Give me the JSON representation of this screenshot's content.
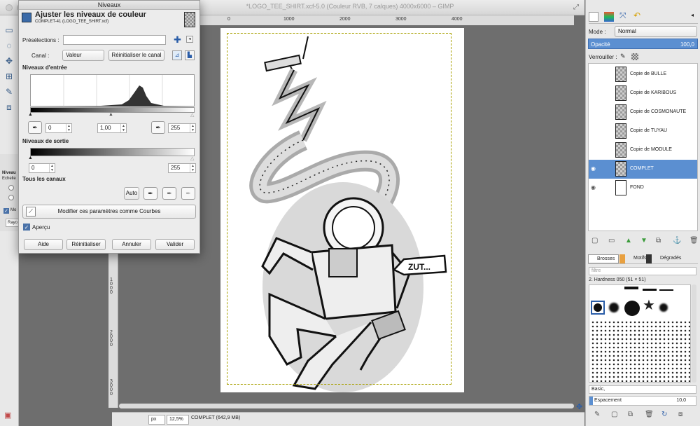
{
  "main_window": {
    "title": "*LOGO_TEE_SHIRT.xcf-5.0 (Couleur RVB, 7 calques) 4000x6000 – GIMP"
  },
  "rulers": {
    "h_labels": [
      "0",
      "1000",
      "2000",
      "3000",
      "4000"
    ],
    "v_labels": [
      "1000",
      "2000",
      "3000",
      "4000",
      "5000"
    ]
  },
  "toolbox_partial": {
    "labels": [
      "Niveau",
      "Echelle",
      "Mo",
      "Rayo"
    ]
  },
  "statusbar": {
    "unit": "px",
    "zoom": "12,5%",
    "info": "COMPLET (642,9 MB)"
  },
  "canvas": {
    "speech_bubble": "ZUT..."
  },
  "dialog": {
    "window_title": "Niveaux",
    "heading": "Ajuster les niveaux de couleur",
    "subheading": "COMPLET-41 (LOGO_TEE_SHIRT.xcf)",
    "presets_label": "Présélections :",
    "presets_value": "",
    "channel_label": "Canal :",
    "channel_value": "Valeur",
    "reset_channel": "Réinitialiser le canal",
    "input_levels_label": "Niveaux d'entrée",
    "input_low": "0",
    "input_gamma": "1,00",
    "input_high": "255",
    "output_levels_label": "Niveaux de sortie",
    "output_low": "0",
    "output_high": "255",
    "all_channels_label": "Tous les canaux",
    "auto": "Auto",
    "edit_curves": "Modifier ces paramètres comme Courbes",
    "preview_label": "Aperçu",
    "preview_checked": true,
    "buttons": {
      "help": "Aide",
      "reset": "Réinitialiser",
      "cancel": "Annuler",
      "ok": "Valider"
    }
  },
  "layers_panel": {
    "mode_label": "Mode :",
    "mode_value": "Normal",
    "opacity_label": "Opacité",
    "opacity_value": "100,0",
    "lock_label": "Verrouiller :",
    "layers": [
      {
        "name": "Copie de BULLE",
        "visible": false,
        "selected": false
      },
      {
        "name": "Copie de KARIBOUS",
        "visible": false,
        "selected": false
      },
      {
        "name": "Copie de COSMONAUTE",
        "visible": false,
        "selected": false
      },
      {
        "name": "Copie de TUYAU",
        "visible": false,
        "selected": false
      },
      {
        "name": "Copie de MODULE",
        "visible": false,
        "selected": false
      },
      {
        "name": "COMPLET",
        "visible": true,
        "selected": true
      },
      {
        "name": "FOND",
        "visible": true,
        "selected": false
      }
    ],
    "accent_color": "#5b8fd1"
  },
  "brushes_panel": {
    "tabs": [
      "Brosses",
      "Motifs",
      "Dégradés"
    ],
    "filter_placeholder": "filtre",
    "current_brush": "2. Hardness 050 (51 × 51)",
    "preset_value": "Basic,",
    "spacing_label": "Espacement",
    "spacing_value": "10,0"
  }
}
